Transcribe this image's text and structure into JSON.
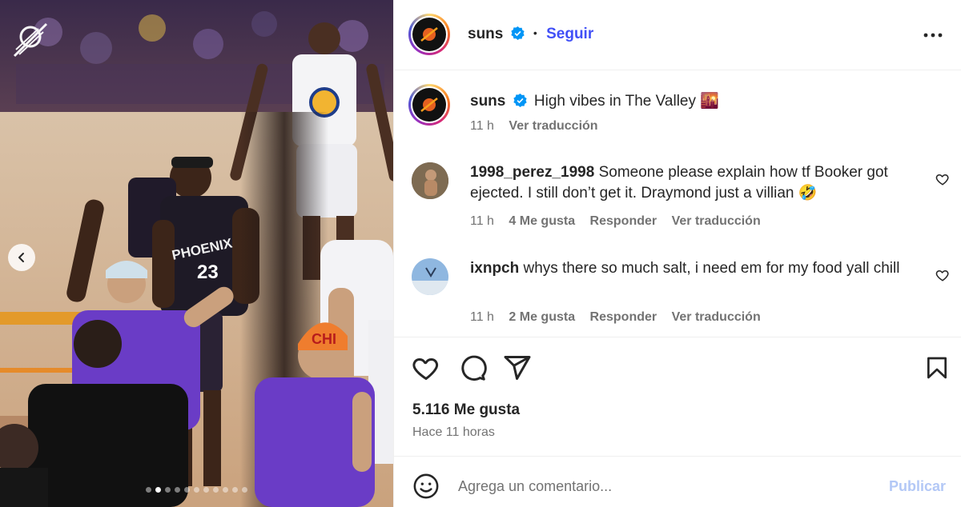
{
  "post": {
    "username": "suns",
    "follow_label": "Seguir",
    "separator": "•",
    "more_icon": "more-horizontal-icon"
  },
  "caption": {
    "username": "suns",
    "text": "High vibes in The Valley",
    "emoji": "🌇",
    "time": "11 h",
    "translate": "Ver traducción"
  },
  "comments": [
    {
      "username": "1998_perez_1998",
      "text": "Someone please explain how tf Booker got ejected. I still don’t get it. Draymond just a villian 🤣",
      "time": "11 h",
      "likes": "4 Me gusta",
      "reply": "Responder",
      "translate": "Ver traducción"
    },
    {
      "username": "ixnpch",
      "text": "whys there so much salt, i need em for my food yall chill",
      "time": "11 h",
      "likes": "2 Me gusta",
      "reply": "Responder",
      "translate": "Ver traducción"
    }
  ],
  "actions": {
    "likes_count": "5.116 Me gusta",
    "posted_ago": "Hace 11 horas"
  },
  "composer": {
    "placeholder": "Agrega un comentario...",
    "publish_label": "Publicar"
  },
  "media": {
    "jersey_number": "23",
    "jersey_team": "PHOENIX",
    "cap_text": "CHI",
    "carousel_dots": 11,
    "active_dot": 1
  },
  "colors": {
    "link_blue": "#4150f7",
    "verified_blue": "#0095f6",
    "publish_disabled": "#b3c8f6"
  }
}
